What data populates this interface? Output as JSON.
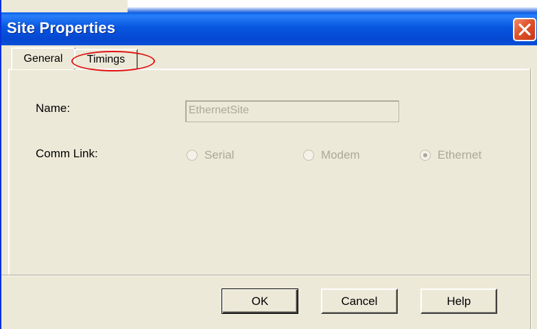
{
  "window": {
    "title": "Site Properties"
  },
  "tabs": [
    {
      "label": "General",
      "selected": true
    },
    {
      "label": "Timings",
      "selected": false,
      "highlighted": true
    }
  ],
  "form": {
    "name_label": "Name:",
    "name_value": "EthernetSite",
    "comm_link_label": "Comm Link:",
    "comm_link_options": [
      {
        "label": "Serial",
        "checked": false
      },
      {
        "label": "Modem",
        "checked": false
      },
      {
        "label": "Ethernet",
        "checked": true
      }
    ]
  },
  "buttons": {
    "ok": "OK",
    "cancel": "Cancel",
    "help": "Help"
  },
  "colors": {
    "titlebar": "#0554d7",
    "face": "#ece9d8",
    "disabled_text": "#aca899",
    "highlight": "#e01010",
    "close": "#e0542a"
  },
  "icons": {
    "close": "close-icon"
  }
}
